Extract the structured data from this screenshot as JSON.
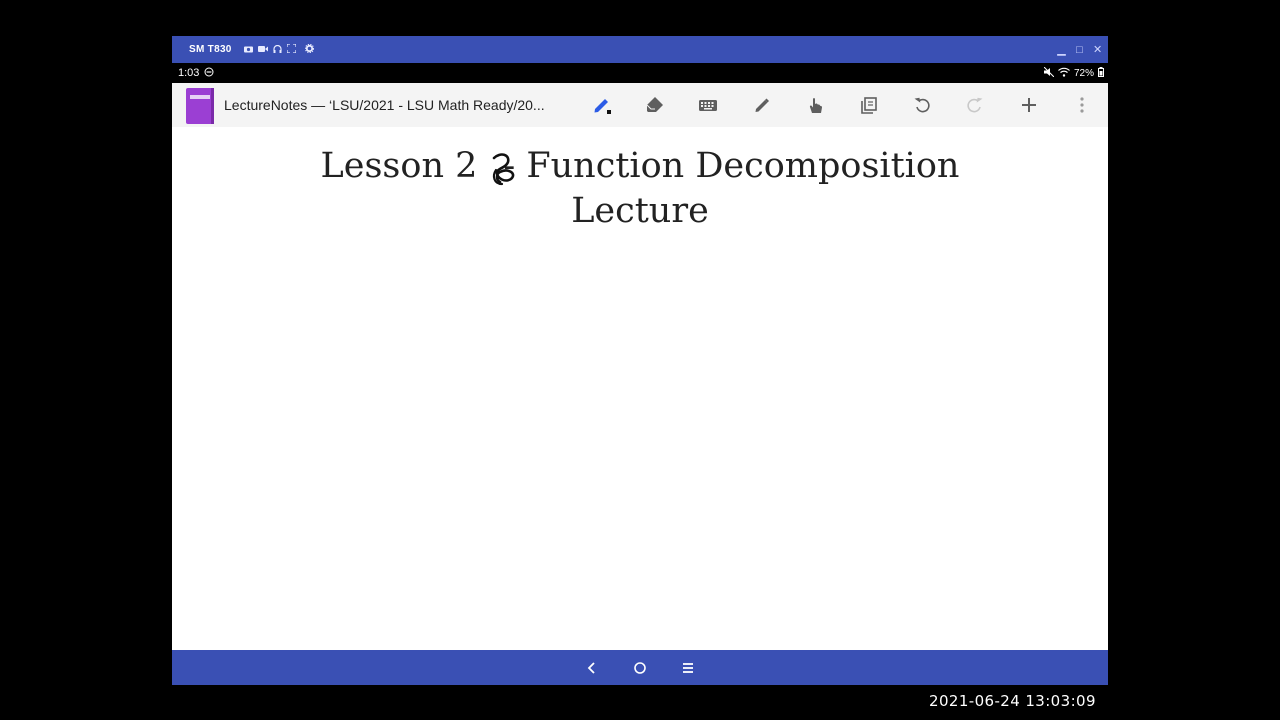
{
  "window": {
    "title": "SM T830",
    "controls": {
      "minimize": "▁",
      "maximize": "□",
      "close": "✕"
    }
  },
  "status_bar": {
    "time": "1:03",
    "battery": "72%"
  },
  "app_bar": {
    "title": "LectureNotes — ‘LSU/2021 - LSU Math Ready/20...",
    "tools": [
      "pen-icon",
      "eraser-icon",
      "keyboard-icon",
      "highlighter-icon",
      "hand-icon",
      "copy-pages-icon",
      "undo-icon",
      "redo-icon",
      "add-icon",
      "more-icon"
    ]
  },
  "note": {
    "line1_prefix": "Lesson 2",
    "line1_suffix": "- Function Decomposition",
    "line2": "Lecture"
  },
  "nav_bar": {
    "buttons": [
      "back-icon",
      "home-icon",
      "recents-icon"
    ]
  },
  "overlay": {
    "timestamp": "2021-06-24 13:03:09"
  },
  "colors": {
    "brand_blue": "#3a50b4",
    "app_icon_purple": "#9b3fd3",
    "pen_blue": "#2c5ce6"
  }
}
